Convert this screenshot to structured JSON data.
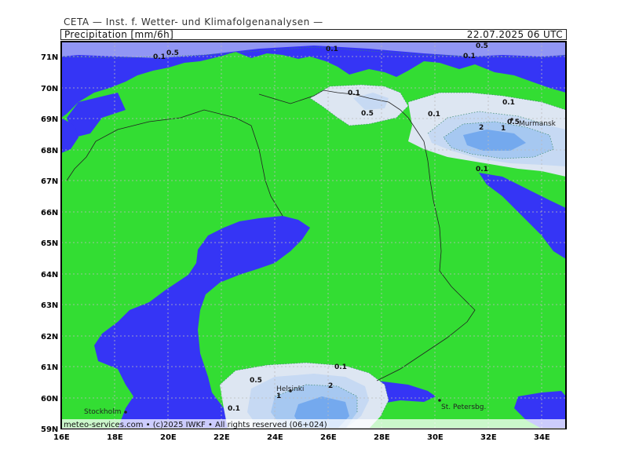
{
  "header": {
    "source": "CETA — Inst. f. Wetter- und Klimafolgenanalysen —",
    "variable": "Precipitation [mm/6h]",
    "valid_time": "22.07.2025 06 UTC"
  },
  "footer": "meteo-services.com • (c)2025 IWKF • All rights reserved (06+024)",
  "axes": {
    "lat_labels": [
      "71N",
      "70N",
      "69N",
      "68N",
      "67N",
      "66N",
      "65N",
      "64N",
      "63N",
      "62N",
      "61N",
      "60N",
      "59N"
    ],
    "lon_labels": [
      "16E",
      "18E",
      "20E",
      "22E",
      "24E",
      "26E",
      "28E",
      "30E",
      "32E",
      "34E"
    ]
  },
  "cities": [
    "Murmansk",
    "Helsinki",
    "Stockholm",
    "St. Petersbg."
  ],
  "contour_labels": [
    "0.1",
    "0.5",
    "0.1",
    "0.1",
    "0.5",
    "0.1",
    "0.5",
    "0.1",
    "2",
    "1",
    "0.5",
    "0.1",
    "0.1",
    "0.5",
    "0.1",
    "2",
    "1",
    "0.1"
  ],
  "colors": {
    "sea": "#3535f5",
    "land": "#33dd33",
    "precip_0_1": "#dde6f2",
    "precip_0_5": "#c6d9f3",
    "precip_1": "#a6c8f1",
    "precip_2": "#74a9ee"
  }
}
